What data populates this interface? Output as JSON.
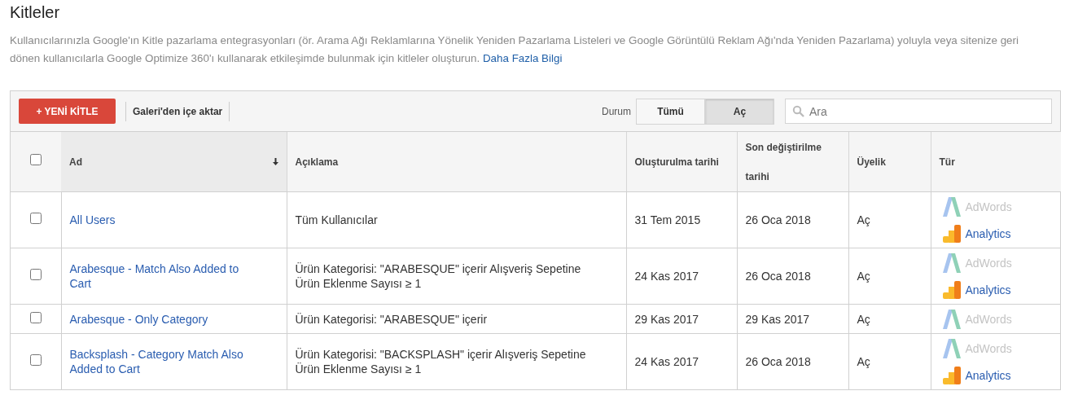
{
  "title": "Kitleler",
  "intro": {
    "text": "Kullanıcılarınızla Google'ın Kitle pazarlama entegrasyonları (ör. Arama Ağı Reklamlarına Yönelik Yeniden Pazarlama Listeleri ve Google Görüntülü Reklam Ağı'nda Yeniden Pazarlama) yoluyla veya sitenize geri dönen kullanıcılarla Google Optimize 360'ı kullanarak etkileşimde bulunmak için kitleler oluşturun.",
    "link": "Daha Fazla Bilgi"
  },
  "toolbar": {
    "new_button": "+ YENİ KİTLE",
    "import_link": "Galeri'den içe aktar",
    "status_label": "Durum",
    "status_options": [
      {
        "label": "Tümü",
        "selected": false
      },
      {
        "label": "Aç",
        "selected": true
      }
    ],
    "search": {
      "placeholder": "Ara"
    }
  },
  "table": {
    "select_all": {
      "checked": false
    },
    "columns": [
      {
        "label": "Ad",
        "sorted": true
      },
      {
        "label": "Açıklama",
        "sorted": false
      },
      {
        "label": "Oluşturulma tarihi",
        "sorted": false
      },
      {
        "label": "Son değiştirilme tarihi",
        "sorted": false
      },
      {
        "label": "Üyelik",
        "sorted": false
      },
      {
        "label": "Tür",
        "sorted": false
      }
    ],
    "rows": [
      {
        "checked": false,
        "name": "All Users",
        "description": "Tüm Kullanıcılar",
        "created": "31 Tem 2015",
        "modified": "26 Oca 2018",
        "membership": "Aç",
        "types": [
          {
            "kind": "adwords",
            "label": "AdWords",
            "disabled": true
          },
          {
            "kind": "analytics",
            "label": "Analytics",
            "disabled": false
          }
        ]
      },
      {
        "checked": false,
        "name": "Arabesque - Match Also Added to Cart",
        "description": "Ürün Kategorisi: \"ARABESQUE\" içerir Alışveriş Sepetine Ürün Eklenme Sayısı ≥ 1",
        "created": "24 Kas 2017",
        "modified": "26 Oca 2018",
        "membership": "Aç",
        "types": [
          {
            "kind": "adwords",
            "label": "AdWords",
            "disabled": true
          },
          {
            "kind": "analytics",
            "label": "Analytics",
            "disabled": false
          }
        ]
      },
      {
        "checked": false,
        "name": "Arabesque - Only Category",
        "description": "Ürün Kategorisi: \"ARABESQUE\" içerir",
        "created": "29 Kas 2017",
        "modified": "29 Kas 2017",
        "membership": "Aç",
        "types": [
          {
            "kind": "adwords",
            "label": "AdWords",
            "disabled": true
          }
        ]
      },
      {
        "checked": false,
        "name": "Backsplash - Category Match Also Added to Cart",
        "description": "Ürün Kategorisi: \"BACKSPLASH\" içerir Alışveriş Sepetine Ürün Eklenme Sayısı ≥ 1",
        "created": "24 Kas 2017",
        "modified": "26 Oca 2018",
        "membership": "Aç",
        "types": [
          {
            "kind": "adwords",
            "label": "AdWords",
            "disabled": true
          },
          {
            "kind": "analytics",
            "label": "Analytics",
            "disabled": false
          }
        ]
      }
    ]
  }
}
